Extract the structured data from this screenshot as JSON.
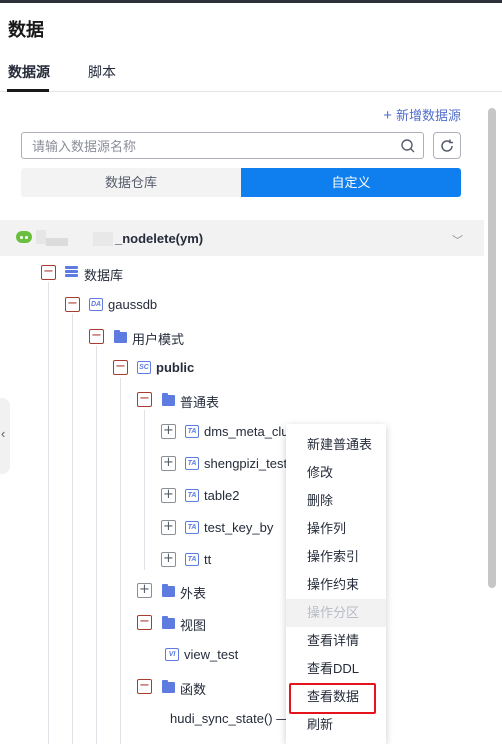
{
  "page": {
    "title": "数据"
  },
  "tabs": [
    {
      "label": "数据源",
      "active": true
    },
    {
      "label": "脚本",
      "active": false
    }
  ],
  "toolbar": {
    "add_datasource": "新增数据源"
  },
  "search": {
    "placeholder": "请输入数据源名称",
    "value": ""
  },
  "segments": [
    {
      "label": "数据仓库",
      "active": false
    },
    {
      "label": "自定义",
      "active": true
    }
  ],
  "connection": {
    "name": "_nodelete(ym)",
    "status_color": "#6abf40"
  },
  "tree": {
    "database_group": "数据库",
    "database": {
      "name": "gaussdb",
      "badge": "DA"
    },
    "schema_group": "用户模式",
    "schema": {
      "name": "public",
      "badge": "SC"
    },
    "table_group": "普通表",
    "tables": [
      {
        "name": "dms_meta_clus",
        "badge": "TA"
      },
      {
        "name": "shengpizi_test",
        "badge": "TA"
      },
      {
        "name": "table2",
        "badge": "TA"
      },
      {
        "name": "test_key_by",
        "badge": "TA"
      },
      {
        "name": "tt",
        "badge": "TA"
      }
    ],
    "foreign_table_group": "外表",
    "view_group": "视图",
    "view": {
      "name": "view_test",
      "badge": "VI"
    },
    "function_group": "函数",
    "function_item": "hudi_sync_state() — r"
  },
  "context_menu": [
    {
      "label": "新建普通表",
      "disabled": false
    },
    {
      "label": "修改",
      "disabled": false
    },
    {
      "label": "删除",
      "disabled": false
    },
    {
      "label": "操作列",
      "disabled": false
    },
    {
      "label": "操作索引",
      "disabled": false
    },
    {
      "label": "操作约束",
      "disabled": false
    },
    {
      "label": "操作分区",
      "disabled": true
    },
    {
      "label": "查看详情",
      "disabled": false
    },
    {
      "label": "查看DDL",
      "disabled": false
    },
    {
      "label": "查看数据",
      "disabled": false,
      "highlighted": true
    },
    {
      "label": "刷新",
      "disabled": false
    }
  ],
  "colors": {
    "accent": "#0f7fef",
    "link": "#526ecc",
    "highlight": "#e5141c"
  }
}
